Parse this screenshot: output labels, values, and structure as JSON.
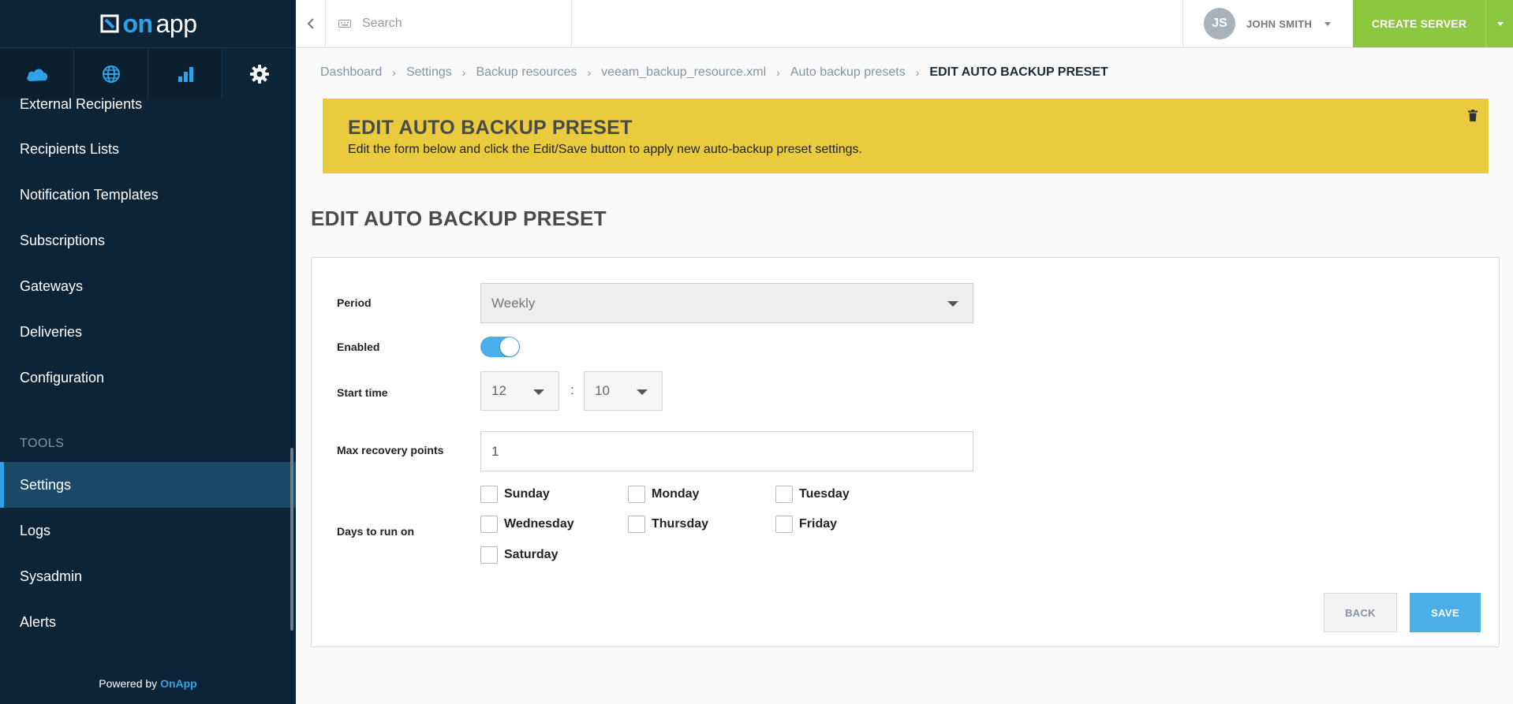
{
  "brand": {
    "logo_text_on": "on",
    "logo_text_app": "app",
    "accent": "#2ea3e8",
    "sidebar_bg": "#0c2438",
    "banner_bg": "#e9cb3d",
    "create_bg": "#8dc63f"
  },
  "sidebar": {
    "tabs": [
      {
        "icon": "cloud-icon"
      },
      {
        "icon": "globe-icon"
      },
      {
        "icon": "bar-chart-icon"
      },
      {
        "icon": "gear-icon"
      }
    ],
    "items_top": [
      "External Recipients",
      "Recipients Lists",
      "Notification Templates",
      "Subscriptions",
      "Gateways",
      "Deliveries",
      "Configuration"
    ],
    "section_tools": "TOOLS",
    "items_tools": [
      "Settings",
      "Logs",
      "Sysadmin",
      "Alerts"
    ],
    "active_item": "Settings",
    "powered_prefix": "Powered by",
    "powered_brand": "OnApp"
  },
  "topbar": {
    "search_placeholder": "Search",
    "user_initials": "JS",
    "user_name": "JOHN SMITH",
    "create_label": "CREATE SERVER"
  },
  "breadcrumb": {
    "items": [
      "Dashboard",
      "Settings",
      "Backup resources",
      "veeam_backup_resource.xml",
      "Auto backup presets"
    ],
    "current": "EDIT AUTO BACKUP PRESET"
  },
  "banner": {
    "title": "EDIT AUTO BACKUP PRESET",
    "text": "Edit the form below and click the Edit/Save button to apply new auto-backup preset settings."
  },
  "page_title": "EDIT AUTO BACKUP PRESET",
  "form": {
    "period_label": "Period",
    "period_value": "Weekly",
    "enabled_label": "Enabled",
    "enabled": true,
    "start_time_label": "Start time",
    "start_hour": "12",
    "start_minute": "10",
    "time_separator": ":",
    "max_recovery_label": "Max recovery points",
    "max_recovery_value": "1",
    "days_label": "Days to run on",
    "days": {
      "sunday": "Sunday",
      "monday": "Monday",
      "tuesday": "Tuesday",
      "wednesday": "Wednesday",
      "thursday": "Thursday",
      "friday": "Friday",
      "saturday": "Saturday"
    },
    "back_label": "BACK",
    "save_label": "SAVE"
  }
}
